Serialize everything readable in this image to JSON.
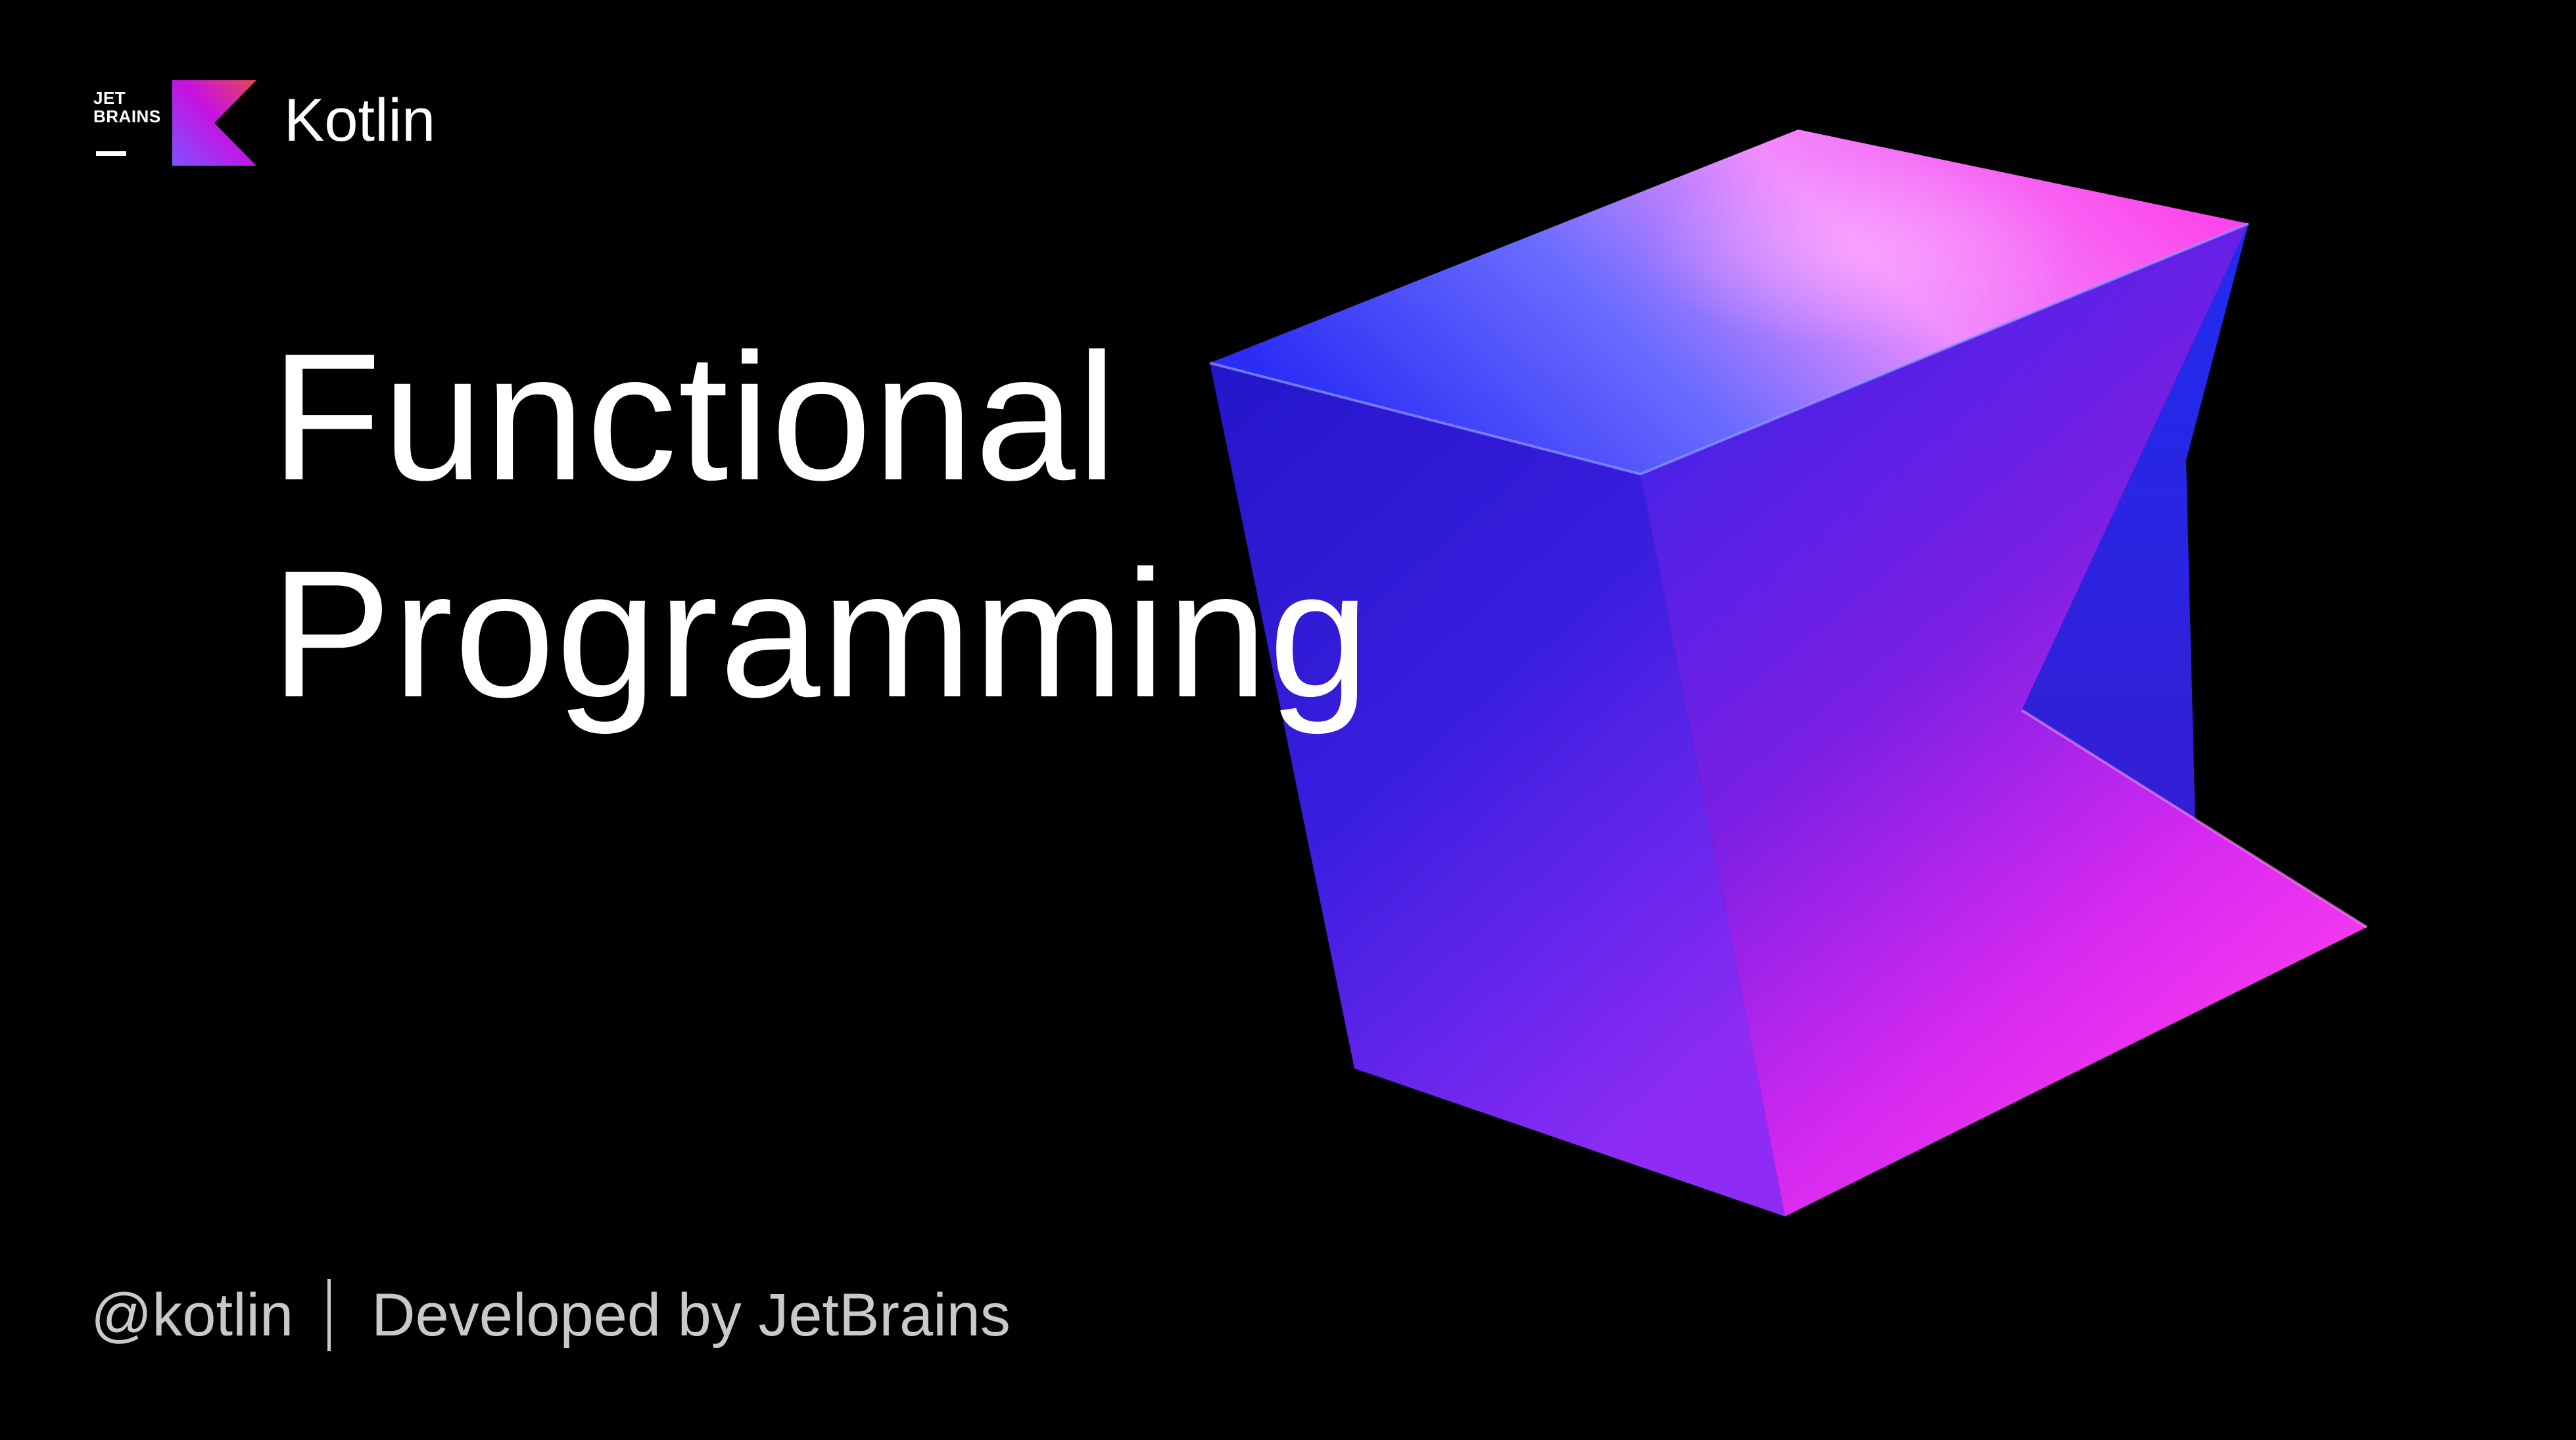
{
  "header": {
    "jetbrains_logo_text": "JET\nBRAINS",
    "product_name": "Kotlin"
  },
  "title": {
    "line1": "Functional",
    "line2": "Programming"
  },
  "footer": {
    "handle": "@kotlin",
    "credit": "Developed by JetBrains"
  },
  "colors": {
    "background": "#000000",
    "text": "#ffffff",
    "footer_text": "#c9c9c9",
    "accent_magenta": "#ff45ed",
    "accent_purple": "#9b2bff",
    "accent_blue": "#3a3cff"
  },
  "icons": {
    "jetbrains_logo": "jetbrains-logo",
    "kotlin_logo": "kotlin-logo"
  }
}
